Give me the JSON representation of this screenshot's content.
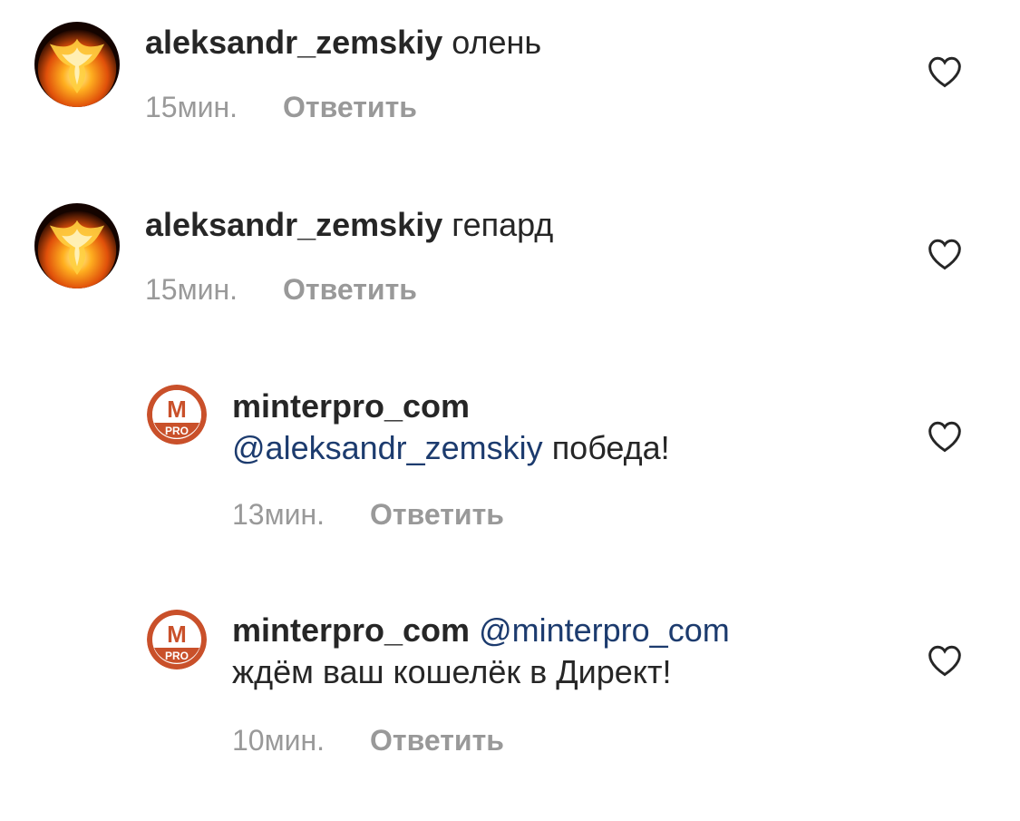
{
  "comments": [
    {
      "username": "aleksandr_zemskiy",
      "text": "олень",
      "time": "15мин.",
      "reply_label": "Ответить",
      "avatar_icon": "phoenix-fire-icon"
    },
    {
      "username": "aleksandr_zemskiy",
      "text": "гепард",
      "time": "15мин.",
      "reply_label": "Ответить",
      "avatar_icon": "phoenix-fire-icon"
    },
    {
      "username": "minterpro_com",
      "mention": "@aleksandr_zemskiy",
      "text": "победа!",
      "time": "13мин.",
      "reply_label": "Ответить",
      "avatar_icon": "minterpro-logo-icon",
      "avatar_logo_letter": "M",
      "avatar_logo_sub": "PRO"
    },
    {
      "username": "minterpro_com",
      "mention": "@minterpro_com",
      "text": "ждём ваш кошелёк в Директ!",
      "time": "10мин.",
      "reply_label": "Ответить",
      "avatar_icon": "minterpro-logo-icon",
      "avatar_logo_letter": "M",
      "avatar_logo_sub": "PRO"
    }
  ],
  "colors": {
    "username": "#262626",
    "mention": "#1c3b6e",
    "meta": "#999999",
    "heart": "#262626",
    "minterpro_brand": "#c9502a"
  },
  "icons": {
    "like": "heart-outline-icon"
  }
}
